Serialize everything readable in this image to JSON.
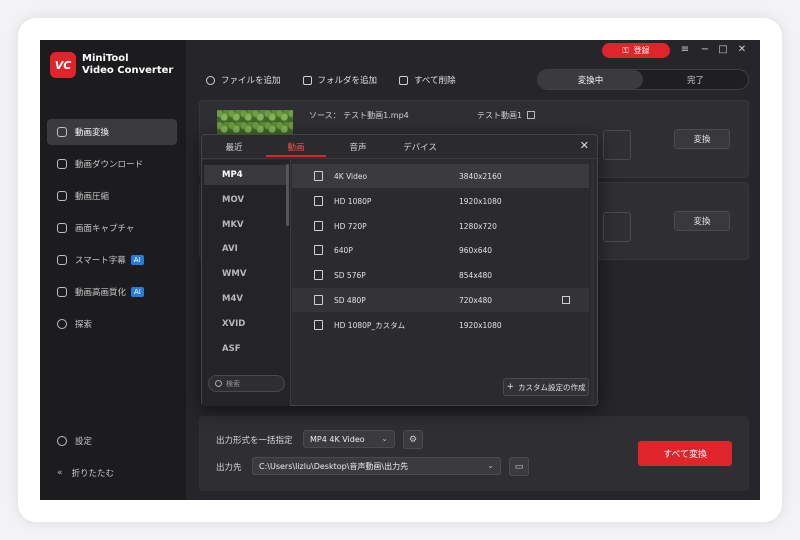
{
  "app": {
    "logo_text": "VC",
    "name_line1": "MiniTool",
    "name_line2": "Video Converter"
  },
  "sidebar": {
    "items": [
      {
        "label": "動画変換",
        "icon": "video-convert-icon",
        "active": true
      },
      {
        "label": "動画ダウンロード",
        "icon": "download-icon"
      },
      {
        "label": "動画圧縮",
        "icon": "compress-icon"
      },
      {
        "label": "画面キャプチャ",
        "icon": "camera-icon"
      },
      {
        "label": "スマート字幕",
        "icon": "subtitle-icon",
        "badge": "AI"
      },
      {
        "label": "動画高画質化",
        "icon": "enhance-icon",
        "badge": "AI"
      },
      {
        "label": "探索",
        "icon": "compass-icon"
      }
    ],
    "settings_label": "設定",
    "collapse_label": "折りたたむ"
  },
  "window": {
    "login_label": "登録",
    "menu_glyph": "≡",
    "minimize_glyph": "−",
    "maximize_glyph": "□",
    "close_glyph": "✕"
  },
  "toolbar": {
    "add_file": "ファイルを追加",
    "add_folder": "フォルダを追加",
    "delete_all": "すべて削除"
  },
  "segment": {
    "converting": "変換中",
    "done": "完了"
  },
  "task": {
    "source": "ソース： テスト動画1.mp4",
    "target": "テスト動画1",
    "convert_label": "変換"
  },
  "format_popup": {
    "tabs": [
      "最近",
      "動画",
      "音声",
      "デバイス"
    ],
    "active_tab": "動画",
    "formats": [
      "MP4",
      "MOV",
      "MKV",
      "AVI",
      "WMV",
      "M4V",
      "XVID",
      "ASF"
    ],
    "active_format": "MP4",
    "search_placeholder": "検索",
    "resolutions": [
      {
        "name": "4K Video",
        "size": "3840x2160"
      },
      {
        "name": "HD 1080P",
        "size": "1920x1080"
      },
      {
        "name": "HD 720P",
        "size": "1280x720"
      },
      {
        "name": "640P",
        "size": "960x640"
      },
      {
        "name": "SD 576P",
        "size": "854x480"
      },
      {
        "name": "SD 480P",
        "size": "720x480"
      },
      {
        "name": "HD 1080P_カスタム",
        "size": "1920x1080"
      }
    ],
    "custom_label": "カスタム設定の作成",
    "close_glyph": "✕"
  },
  "bottom": {
    "output_format_label": "出力形式を一括指定",
    "output_format_value": "MP4 4K Video",
    "output_path_label": "出力先",
    "output_path_value": "C:\\Users\\lizlu\\Desktop\\音声動画\\出力先",
    "convert_all": "すべて変換"
  },
  "colors": {
    "accent": "#e0242c",
    "background": "#26262a",
    "sidebar": "#1c1c1f"
  }
}
